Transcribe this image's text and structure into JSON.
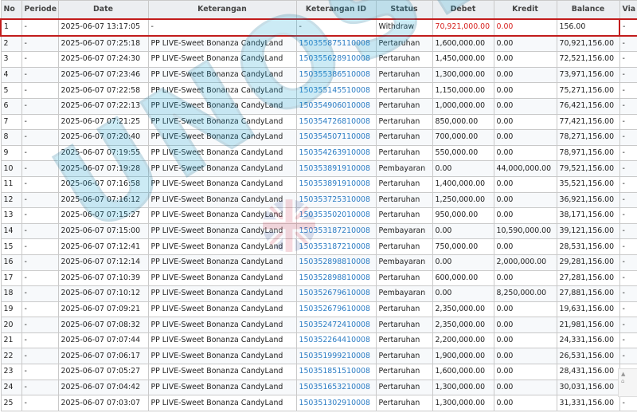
{
  "table": {
    "headers": [
      "No",
      "Periode",
      "Date",
      "Keterangan",
      "Keterangan ID",
      "Status",
      "Debet",
      "Kredit",
      "Balance",
      "Via"
    ],
    "rows": [
      [
        "1",
        "-",
        "2025-06-07 13:17:05",
        "-",
        "-",
        "Withdraw",
        "70,921,000.00",
        "0.00",
        "156.00",
        "-"
      ],
      [
        "2",
        "-",
        "2025-06-07 07:25:18",
        "PP LIVE-Sweet Bonanza CandyLand",
        "150355875110008",
        "Pertaruhan",
        "1,600,000.00",
        "0.00",
        "70,921,156.00",
        "-"
      ],
      [
        "3",
        "-",
        "2025-06-07 07:24:30",
        "PP LIVE-Sweet Bonanza CandyLand",
        "150355628910008",
        "Pertaruhan",
        "1,450,000.00",
        "0.00",
        "72,521,156.00",
        "-"
      ],
      [
        "4",
        "-",
        "2025-06-07 07:23:46",
        "PP LIVE-Sweet Bonanza CandyLand",
        "150355386510008",
        "Pertaruhan",
        "1,300,000.00",
        "0.00",
        "73,971,156.00",
        "-"
      ],
      [
        "5",
        "-",
        "2025-06-07 07:22:58",
        "PP LIVE-Sweet Bonanza CandyLand",
        "150355145510008",
        "Pertaruhan",
        "1,150,000.00",
        "0.00",
        "75,271,156.00",
        "-"
      ],
      [
        "6",
        "-",
        "2025-06-07 07:22:13",
        "PP LIVE-Sweet Bonanza CandyLand",
        "150354906010008",
        "Pertaruhan",
        "1,000,000.00",
        "0.00",
        "76,421,156.00",
        "-"
      ],
      [
        "7",
        "-",
        "2025-06-07 07:21:25",
        "PP LIVE-Sweet Bonanza CandyLand",
        "150354726810008",
        "Pertaruhan",
        "850,000.00",
        "0.00",
        "77,421,156.00",
        "-"
      ],
      [
        "8",
        "-",
        "2025-06-07 07:20:40",
        "PP LIVE-Sweet Bonanza CandyLand",
        "150354507110008",
        "Pertaruhan",
        "700,000.00",
        "0.00",
        "78,271,156.00",
        "-"
      ],
      [
        "9",
        "-",
        "2025-06-07 07:19:55",
        "PP LIVE-Sweet Bonanza CandyLand",
        "150354263910008",
        "Pertaruhan",
        "550,000.00",
        "0.00",
        "78,971,156.00",
        "-"
      ],
      [
        "10",
        "-",
        "2025-06-07 07:19:28",
        "PP LIVE-Sweet Bonanza CandyLand",
        "150353891910008",
        "Pembayaran",
        "0.00",
        "44,000,000.00",
        "79,521,156.00",
        "-"
      ],
      [
        "11",
        "-",
        "2025-06-07 07:16:58",
        "PP LIVE-Sweet Bonanza CandyLand",
        "150353891910008",
        "Pertaruhan",
        "1,400,000.00",
        "0.00",
        "35,521,156.00",
        "-"
      ],
      [
        "12",
        "-",
        "2025-06-07 07:16:12",
        "PP LIVE-Sweet Bonanza CandyLand",
        "150353725310008",
        "Pertaruhan",
        "1,250,000.00",
        "0.00",
        "36,921,156.00",
        "-"
      ],
      [
        "13",
        "-",
        "2025-06-07 07:15:27",
        "PP LIVE-Sweet Bonanza CandyLand",
        "150353502010008",
        "Pertaruhan",
        "950,000.00",
        "0.00",
        "38,171,156.00",
        "-"
      ],
      [
        "14",
        "-",
        "2025-06-07 07:15:00",
        "PP LIVE-Sweet Bonanza CandyLand",
        "150353187210008",
        "Pembayaran",
        "0.00",
        "10,590,000.00",
        "39,121,156.00",
        "-"
      ],
      [
        "15",
        "-",
        "2025-06-07 07:12:41",
        "PP LIVE-Sweet Bonanza CandyLand",
        "150353187210008",
        "Pertaruhan",
        "750,000.00",
        "0.00",
        "28,531,156.00",
        "-"
      ],
      [
        "16",
        "-",
        "2025-06-07 07:12:14",
        "PP LIVE-Sweet Bonanza CandyLand",
        "150352898810008",
        "Pembayaran",
        "0.00",
        "2,000,000.00",
        "29,281,156.00",
        "-"
      ],
      [
        "17",
        "-",
        "2025-06-07 07:10:39",
        "PP LIVE-Sweet Bonanza CandyLand",
        "150352898810008",
        "Pertaruhan",
        "600,000.00",
        "0.00",
        "27,281,156.00",
        "-"
      ],
      [
        "18",
        "-",
        "2025-06-07 07:10:12",
        "PP LIVE-Sweet Bonanza CandyLand",
        "150352679610008",
        "Pembayaran",
        "0.00",
        "8,250,000.00",
        "27,881,156.00",
        "-"
      ],
      [
        "19",
        "-",
        "2025-06-07 07:09:21",
        "PP LIVE-Sweet Bonanza CandyLand",
        "150352679610008",
        "Pertaruhan",
        "2,350,000.00",
        "0.00",
        "19,631,156.00",
        "-"
      ],
      [
        "20",
        "-",
        "2025-06-07 07:08:32",
        "PP LIVE-Sweet Bonanza CandyLand",
        "150352472410008",
        "Pertaruhan",
        "2,350,000.00",
        "0.00",
        "21,981,156.00",
        "-"
      ],
      [
        "21",
        "-",
        "2025-06-07 07:07:44",
        "PP LIVE-Sweet Bonanza CandyLand",
        "150352264410008",
        "Pertaruhan",
        "2,200,000.00",
        "0.00",
        "24,331,156.00",
        "-"
      ],
      [
        "22",
        "-",
        "2025-06-07 07:06:17",
        "PP LIVE-Sweet Bonanza CandyLand",
        "150351999210008",
        "Pertaruhan",
        "1,900,000.00",
        "0.00",
        "26,531,156.00",
        "-"
      ],
      [
        "23",
        "-",
        "2025-06-07 07:05:27",
        "PP LIVE-Sweet Bonanza CandyLand",
        "150351851510008",
        "Pertaruhan",
        "1,600,000.00",
        "0.00",
        "28,431,156.00",
        "-"
      ],
      [
        "24",
        "-",
        "2025-06-07 07:04:42",
        "PP LIVE-Sweet Bonanza CandyLand",
        "150351653210008",
        "Pertaruhan",
        "1,300,000.00",
        "0.00",
        "30,031,156.00",
        "-"
      ],
      [
        "25",
        "-",
        "2025-06-07 07:03:07",
        "PP LIVE-Sweet Bonanza CandyLand",
        "150351302910008",
        "Pertaruhan",
        "1,300,000.00",
        "0.00",
        "31,331,156.00",
        "-"
      ]
    ]
  },
  "watermark": {
    "text": "UNOSLOT",
    "color": "#1ea7d6"
  },
  "colors": {
    "link": "#2b7cc4",
    "highlight_border": "#c21c1c",
    "negative": "#d6201e",
    "header_bg": "#eceef1"
  }
}
